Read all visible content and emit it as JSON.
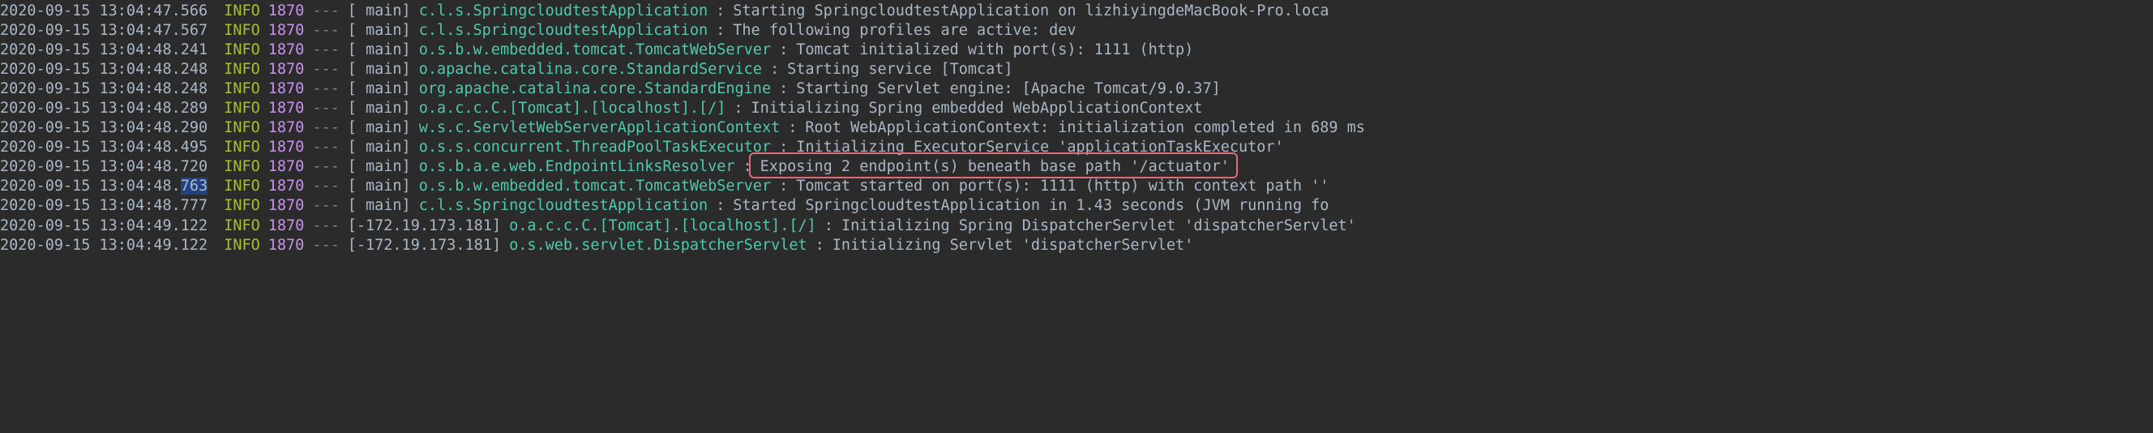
{
  "logs": [
    {
      "timestamp": "2020-09-15 13:04:47.566",
      "level": "INFO",
      "pid": "1870",
      "separator": "---",
      "thread": "[            main]",
      "logger": "c.l.s.SpringcloudtestApplication        ",
      "message": "Starting SpringcloudtestApplication on lizhiyingdeMacBook-Pro.loca"
    },
    {
      "timestamp": "2020-09-15 13:04:47.567",
      "level": "INFO",
      "pid": "1870",
      "separator": "---",
      "thread": "[            main]",
      "logger": "c.l.s.SpringcloudtestApplication        ",
      "message": "The following profiles are active: dev"
    },
    {
      "timestamp": "2020-09-15 13:04:48.241",
      "level": "INFO",
      "pid": "1870",
      "separator": "---",
      "thread": "[            main]",
      "logger": "o.s.b.w.embedded.tomcat.TomcatWebServer ",
      "message": "Tomcat initialized with port(s): 1111 (http)"
    },
    {
      "timestamp": "2020-09-15 13:04:48.248",
      "level": "INFO",
      "pid": "1870",
      "separator": "---",
      "thread": "[            main]",
      "logger": "o.apache.catalina.core.StandardService  ",
      "message": "Starting service [Tomcat]"
    },
    {
      "timestamp": "2020-09-15 13:04:48.248",
      "level": "INFO",
      "pid": "1870",
      "separator": "---",
      "thread": "[            main]",
      "logger": "org.apache.catalina.core.StandardEngine ",
      "message": "Starting Servlet engine: [Apache Tomcat/9.0.37]"
    },
    {
      "timestamp": "2020-09-15 13:04:48.289",
      "level": "INFO",
      "pid": "1870",
      "separator": "---",
      "thread": "[            main]",
      "logger": "o.a.c.c.C.[Tomcat].[localhost].[/]      ",
      "message": "Initializing Spring embedded WebApplicationContext"
    },
    {
      "timestamp": "2020-09-15 13:04:48.290",
      "level": "INFO",
      "pid": "1870",
      "separator": "---",
      "thread": "[            main]",
      "logger": "w.s.c.ServletWebServerApplicationContext",
      "message": "Root WebApplicationContext: initialization completed in 689 ms"
    },
    {
      "timestamp": "2020-09-15 13:04:48.495",
      "level": "INFO",
      "pid": "1870",
      "separator": "---",
      "thread": "[            main]",
      "logger": "o.s.s.concurrent.ThreadPoolTaskExecutor ",
      "message": "Initializing ExecutorService 'applicationTaskExecutor'"
    },
    {
      "timestamp": "2020-09-15 13:04:48.720",
      "level": "INFO",
      "pid": "1870",
      "separator": "---",
      "thread": "[            main]",
      "logger": "o.s.b.a.e.web.EndpointLinksResolver     ",
      "message": "Exposing 2 endpoint(s) beneath base path '/actuator'",
      "highlighted": true
    },
    {
      "timestamp": "2020-09-15 13:04:48.763",
      "level": "INFO",
      "pid": "1870",
      "separator": "---",
      "thread": "[            main]",
      "logger": "o.s.b.w.embedded.tomcat.TomcatWebServer ",
      "message": "Tomcat started on port(s): 1111 (http) with context path ''",
      "selectedChars": "763"
    },
    {
      "timestamp": "2020-09-15 13:04:48.777",
      "level": "INFO",
      "pid": "1870",
      "separator": "---",
      "thread": "[            main]",
      "logger": "c.l.s.SpringcloudtestApplication        ",
      "message": "Started SpringcloudtestApplication in 1.43 seconds (JVM running fo"
    },
    {
      "timestamp": "2020-09-15 13:04:49.122",
      "level": "INFO",
      "pid": "1870",
      "separator": "---",
      "thread": "[-172.19.173.181]",
      "logger": "o.a.c.c.C.[Tomcat].[localhost].[/]      ",
      "message": "Initializing Spring DispatcherServlet 'dispatcherServlet'"
    },
    {
      "timestamp": "2020-09-15 13:04:49.122",
      "level": "INFO",
      "pid": "1870",
      "separator": "---",
      "thread": "[-172.19.173.181]",
      "logger": "o.s.web.servlet.DispatcherServlet       ",
      "message": "Initializing Servlet 'dispatcherServlet'"
    }
  ]
}
